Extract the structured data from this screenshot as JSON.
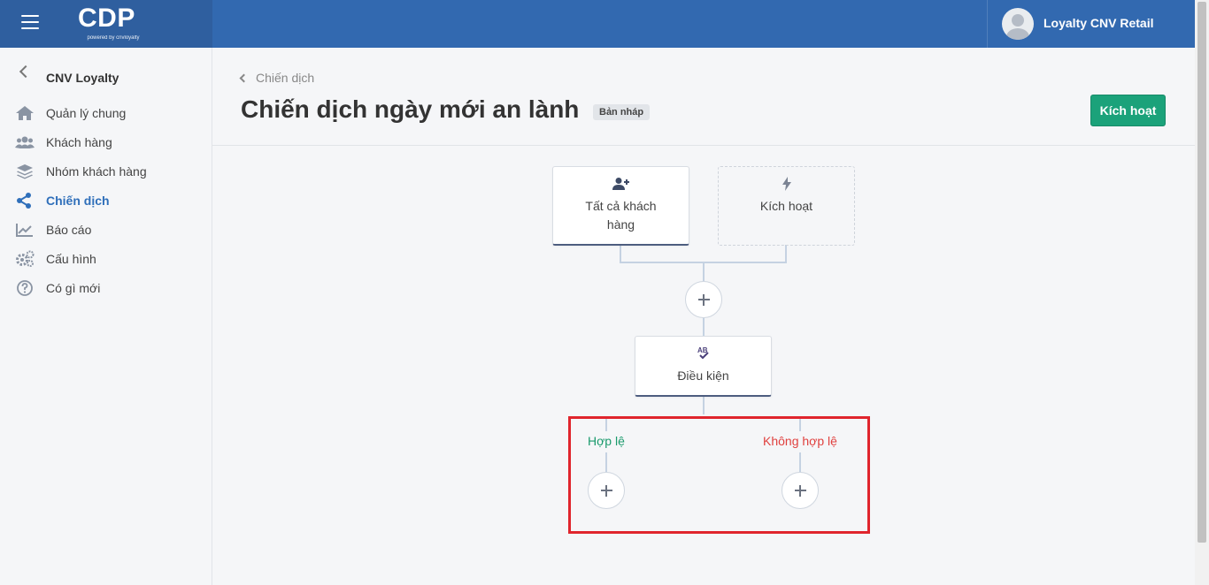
{
  "header": {
    "logo_text": "CDP",
    "logo_sub": "powered by cnvloyalty",
    "user_name": "Loyalty CNV Retail"
  },
  "sidebar": {
    "back_title": "CNV Loyalty",
    "items": [
      {
        "label": "Quản lý chung",
        "icon": "home-icon",
        "active": false
      },
      {
        "label": "Khách hàng",
        "icon": "users-icon",
        "active": false
      },
      {
        "label": "Nhóm khách hàng",
        "icon": "layers-icon",
        "active": false
      },
      {
        "label": "Chiến dịch",
        "icon": "share-icon",
        "active": true
      },
      {
        "label": "Báo cáo",
        "icon": "chart-line-icon",
        "active": false
      },
      {
        "label": "Cấu hình",
        "icon": "gears-icon",
        "active": false
      },
      {
        "label": "Có gì mới",
        "icon": "question-circle-icon",
        "active": false
      }
    ]
  },
  "main": {
    "breadcrumb": "Chiến dịch",
    "title": "Chiến dịch ngày mới an lành",
    "status_badge": "Bản nháp",
    "activate_button": "Kích hoạt"
  },
  "flow": {
    "audience_node": {
      "label_line1": "Tất cả khách",
      "label_line2": "hàng",
      "icon": "user-plus-icon"
    },
    "trigger_node": {
      "label": "Kích hoạt",
      "icon": "bolt-icon"
    },
    "condition_node": {
      "label": "Điều kiện",
      "icon": "spell-check-icon"
    },
    "branch_valid": "Hợp lệ",
    "branch_invalid": "Không hợp lệ"
  },
  "colors": {
    "topbar": "#3269b0",
    "accent_green": "#1ba27a",
    "active_link": "#2f6fba",
    "valid": "#1a9a6c",
    "invalid": "#e0413f",
    "highlight": "#e0252d"
  }
}
